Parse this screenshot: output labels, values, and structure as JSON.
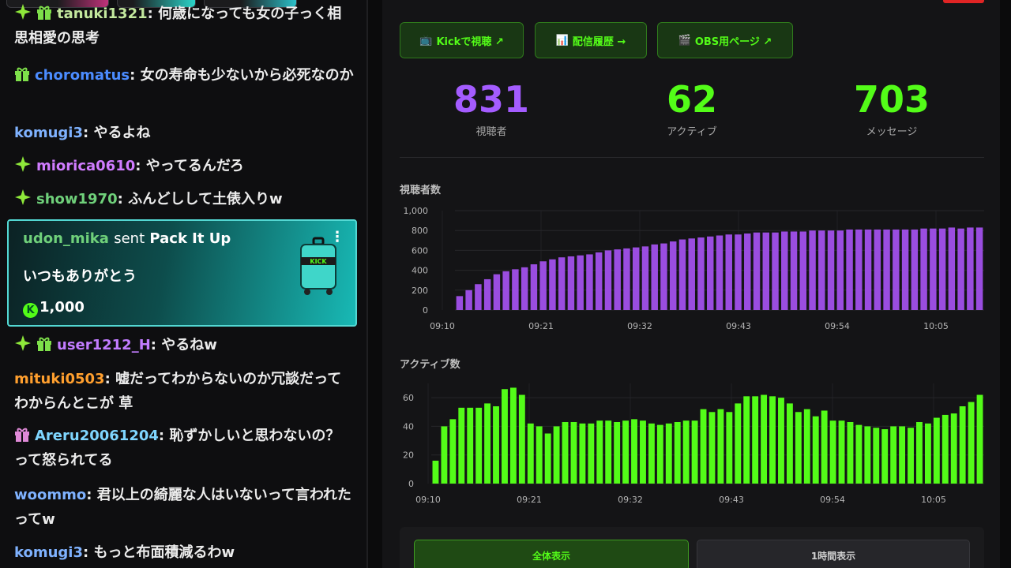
{
  "chat": {
    "messages": [
      {
        "user": "tanuki1321",
        "color": "#c3e89e",
        "text": "何歳になっても女の子っく相思相愛の思考",
        "badges": [
          "star",
          "gift"
        ],
        "top": 2
      },
      {
        "user": "choromatus",
        "color": "#4b8cff",
        "text": "女の寿命も少ないから必死なのか",
        "badges": [
          "gift"
        ],
        "top": 80
      },
      {
        "user": "komugi3",
        "color": "#7fb2ff",
        "text": "やるよね",
        "badges": [],
        "top": 153
      },
      {
        "user": "miorica0610",
        "color": "#d07cff",
        "text": "やってるんだろ",
        "badges": [
          "star"
        ],
        "top": 195
      },
      {
        "user": "show1970",
        "color": "#6fd07a",
        "text": "ふんどしして土俵入りw",
        "badges": [
          "star"
        ],
        "top": 237
      },
      {
        "user": "user1212_H",
        "color": "#c27cff",
        "text": "やるねw",
        "badges": [
          "star",
          "gift"
        ],
        "top": 422
      },
      {
        "user": "mituki0503",
        "color": "#ff9f2e",
        "text": "嘘だってわからないのか冗談だってわからんとこが 草",
        "badges": [],
        "top": 465
      },
      {
        "user": "Areru20061204",
        "color": "#7fd6ff",
        "text": "恥ずかしいと思わないの？って怒られてる",
        "badges": [
          "gift-pink"
        ],
        "top": 537
      },
      {
        "user": "woommo",
        "color": "#7fb2ff",
        "text": "君以上の綺麗な人はいないって言われたってw",
        "badges": [],
        "top": 612
      },
      {
        "user": "komugi3",
        "color": "#7fb2ff",
        "text": "もっと布面積減るわw",
        "badges": [],
        "top": 685
      }
    ],
    "gift": {
      "user": "udon_mika",
      "sent": "sent",
      "item": "Pack It Up",
      "message": "いつもありがとう",
      "amount": "1,000"
    }
  },
  "panel": {
    "buttons": [
      {
        "label": "Kickで視聴 ↗",
        "icon": "📺"
      },
      {
        "label": "配信履歴 →",
        "icon": "📊"
      },
      {
        "label": "OBS用ページ ↗",
        "icon": "🎬"
      }
    ],
    "stats": [
      {
        "value": "831",
        "label": "視聴者",
        "color": "#a45cff"
      },
      {
        "value": "62",
        "label": "アクティブ",
        "color": "#53fc18"
      },
      {
        "value": "703",
        "label": "メッセージ",
        "color": "#53fc18"
      }
    ],
    "viewer_chart_title": "視聴者数",
    "active_chart_title": "アクティブ数",
    "toggle": {
      "all": "全体表示",
      "hour": "1時間表示"
    },
    "accent": "#53fc18",
    "purple": "#9a4de0"
  },
  "chart_data": [
    {
      "type": "bar",
      "title": "視聴者数",
      "ylim": [
        0,
        1000
      ],
      "yticks": [
        "0",
        "200",
        "400",
        "600",
        "800",
        "1,000"
      ],
      "xticks": [
        "09:10",
        "09:21",
        "09:32",
        "09:43",
        "09:54",
        "10:05"
      ],
      "values": [
        140,
        200,
        260,
        310,
        360,
        390,
        410,
        430,
        460,
        490,
        510,
        530,
        540,
        550,
        560,
        580,
        600,
        610,
        620,
        630,
        640,
        660,
        670,
        690,
        710,
        720,
        730,
        740,
        750,
        760,
        760,
        770,
        780,
        780,
        780,
        790,
        790,
        790,
        800,
        800,
        800,
        800,
        810,
        810,
        810,
        810,
        810,
        810,
        810,
        810,
        820,
        820,
        820,
        830,
        820,
        830,
        830
      ]
    },
    {
      "type": "bar",
      "title": "アクティブ数",
      "ylim": [
        0,
        70
      ],
      "yticks": [
        "0",
        "20",
        "40",
        "60"
      ],
      "xticks": [
        "09:10",
        "09:21",
        "09:32",
        "09:43",
        "09:54",
        "10:05"
      ],
      "values": [
        16,
        40,
        45,
        53,
        53,
        53,
        56,
        54,
        66,
        67,
        62,
        42,
        40,
        35,
        40,
        43,
        43,
        42,
        42,
        44,
        44,
        43,
        44,
        45,
        44,
        42,
        41,
        42,
        43,
        44,
        44,
        52,
        50,
        52,
        50,
        56,
        61,
        61,
        62,
        61,
        60,
        56,
        50,
        52,
        47,
        51,
        44,
        44,
        43,
        41,
        40,
        39,
        38,
        40,
        40,
        39,
        43,
        42,
        46,
        48,
        49,
        54,
        57,
        62
      ]
    }
  ]
}
